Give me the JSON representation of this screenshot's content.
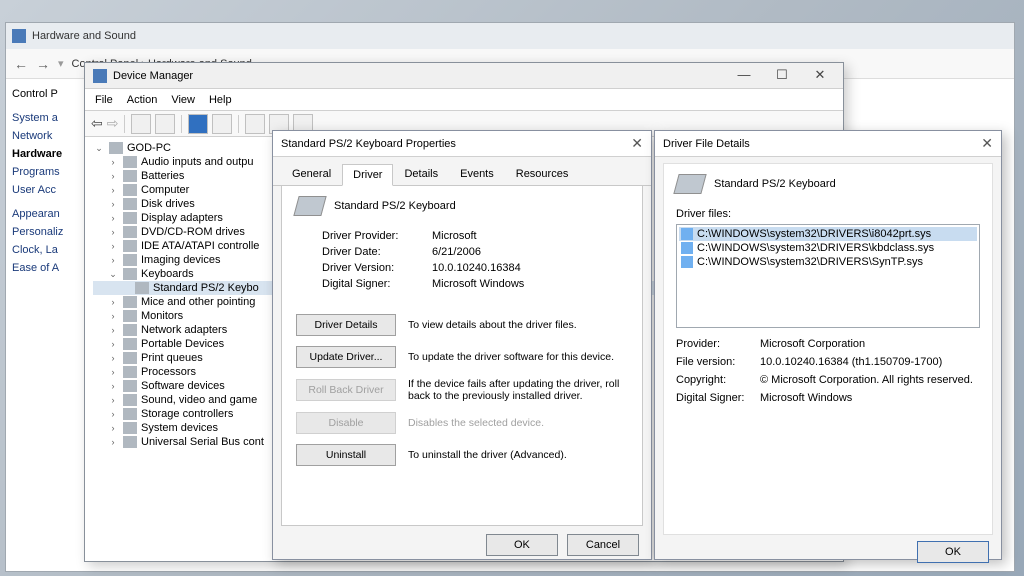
{
  "controlPanel": {
    "title": "Hardware and Sound",
    "crumb": "Control Panel  ›  Hardware and Sound",
    "sideLabel": "Control P",
    "links": [
      "System a",
      "Network",
      "Hardware",
      "Programs",
      "User Acc",
      "",
      "Appearan",
      "Personaliz",
      "Clock, La",
      "Ease of A"
    ]
  },
  "deviceManager": {
    "title": "Device Manager",
    "menus": [
      "File",
      "Action",
      "View",
      "Help"
    ],
    "root": "GOD-PC",
    "nodes": [
      "Audio inputs and outpu",
      "Batteries",
      "Computer",
      "Disk drives",
      "Display adapters",
      "DVD/CD-ROM drives",
      "IDE ATA/ATAPI controlle",
      "Imaging devices",
      "Keyboards",
      "Mice and other pointing",
      "Monitors",
      "Network adapters",
      "Portable Devices",
      "Print queues",
      "Processors",
      "Software devices",
      "Sound, video and game",
      "Storage controllers",
      "System devices",
      "Universal Serial Bus cont"
    ],
    "keyboardChild": "Standard PS/2 Keybo"
  },
  "props": {
    "title": "Standard PS/2 Keyboard Properties",
    "tabs": [
      "General",
      "Driver",
      "Details",
      "Events",
      "Resources"
    ],
    "deviceName": "Standard PS/2 Keyboard",
    "providerLabel": "Driver Provider:",
    "provider": "Microsoft",
    "dateLabel": "Driver Date:",
    "date": "6/21/2006",
    "versionLabel": "Driver Version:",
    "version": "10.0.10240.16384",
    "signerLabel": "Digital Signer:",
    "signer": "Microsoft Windows",
    "btnDetails": "Driver Details",
    "descDetails": "To view details about the driver files.",
    "btnUpdate": "Update Driver...",
    "descUpdate": "To update the driver software for this device.",
    "btnRollback": "Roll Back Driver",
    "descRollback": "If the device fails after updating the driver, roll back to the previously installed driver.",
    "btnDisable": "Disable",
    "descDisable": "Disables the selected device.",
    "btnUninstall": "Uninstall",
    "descUninstall": "To uninstall the driver (Advanced).",
    "ok": "OK",
    "cancel": "Cancel"
  },
  "dfd": {
    "title": "Driver File Details",
    "deviceName": "Standard PS/2 Keyboard",
    "filesLabel": "Driver files:",
    "files": [
      "C:\\WINDOWS\\system32\\DRIVERS\\i8042prt.sys",
      "C:\\WINDOWS\\system32\\DRIVERS\\kbdclass.sys",
      "C:\\WINDOWS\\system32\\DRIVERS\\SynTP.sys"
    ],
    "providerLabel": "Provider:",
    "provider": "Microsoft Corporation",
    "versionLabel": "File version:",
    "version": "10.0.10240.16384 (th1.150709-1700)",
    "copyrightLabel": "Copyright:",
    "copyright": "© Microsoft Corporation. All rights reserved.",
    "signerLabel": "Digital Signer:",
    "signer": "Microsoft Windows",
    "ok": "OK"
  }
}
